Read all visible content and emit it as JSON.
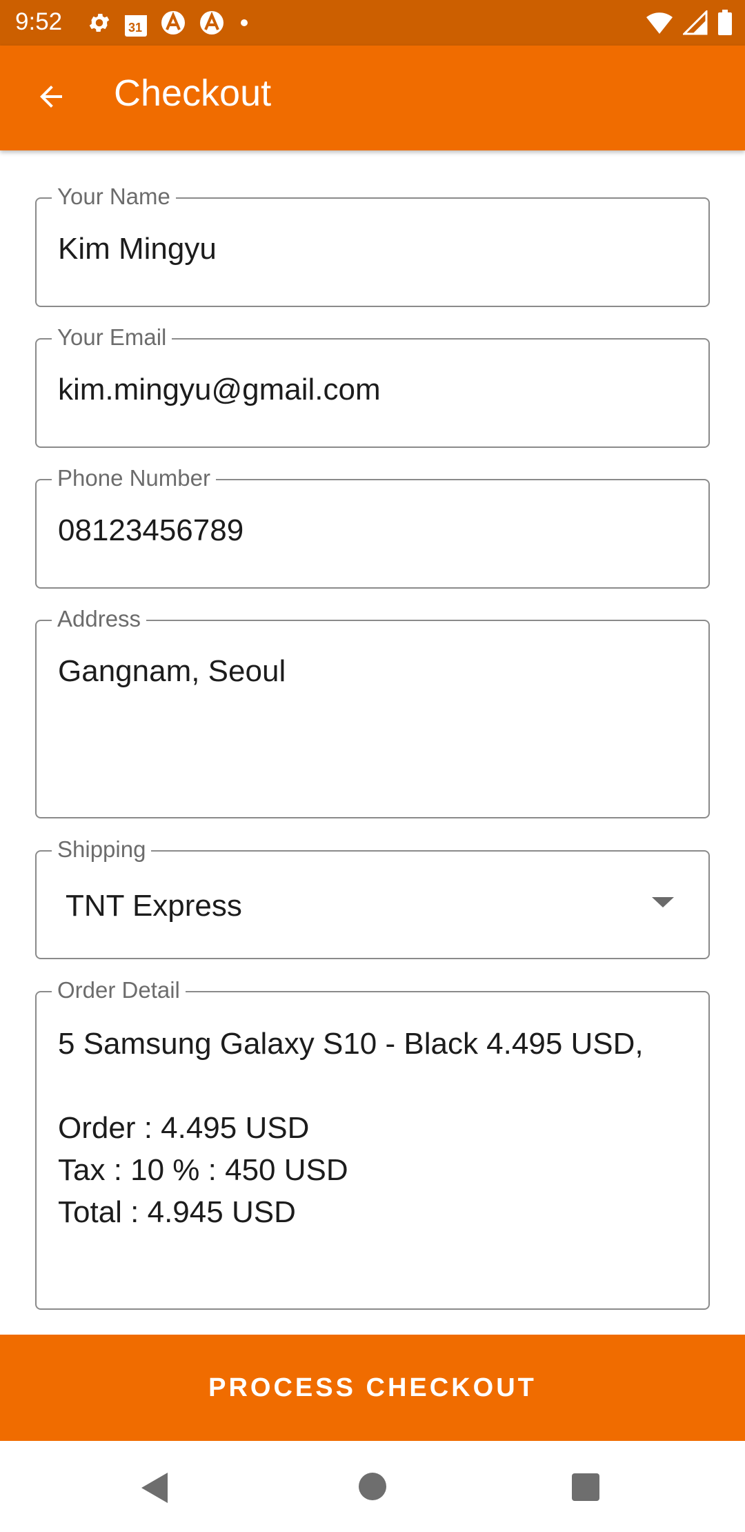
{
  "status_bar": {
    "time": "9:52",
    "left_icons": [
      "gear-icon",
      "calendar-icon",
      "app-a-icon",
      "app-a-icon",
      "dot-icon"
    ],
    "calendar_day": "31",
    "right_icons": [
      "wifi-icon",
      "signal-icon",
      "battery-icon"
    ]
  },
  "app_bar": {
    "title": "Checkout",
    "back_icon": "arrow-back-icon",
    "color": "#f06c00"
  },
  "form": {
    "name": {
      "label": "Your Name",
      "value": "Kim Mingyu"
    },
    "email": {
      "label": "Your Email",
      "value": "kim.mingyu@gmail.com"
    },
    "phone": {
      "label": "Phone Number",
      "value": "08123456789"
    },
    "address": {
      "label": "Address",
      "value": "Gangnam, Seoul"
    },
    "shipping": {
      "label": "Shipping",
      "selected": "TNT Express"
    },
    "order_detail": {
      "label": "Order Detail",
      "value": "5 Samsung Galaxy S10 - Black 4.495 USD,\n\nOrder : 4.495 USD\nTax : 10 % : 450 USD\nTotal : 4.945 USD"
    }
  },
  "checkout_button": {
    "label": "PROCESS CHECKOUT"
  },
  "nav_bar": {
    "icons": [
      "nav-back-icon",
      "nav-home-icon",
      "nav-recents-icon"
    ]
  }
}
